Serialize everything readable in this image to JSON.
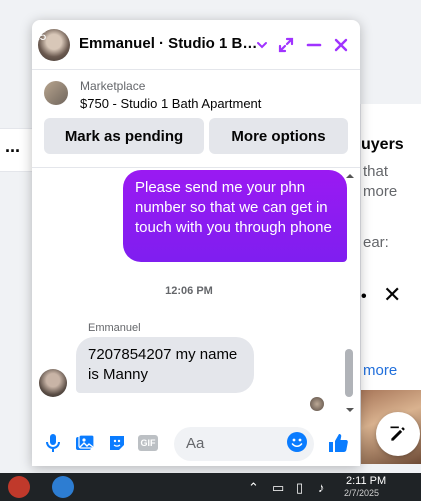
{
  "background": {
    "dots": "...",
    "right_heading": "uyers",
    "right_line1": "that",
    "right_line2": "more",
    "right_line3": "ear:",
    "right_dot": "•",
    "right_close": "✕",
    "right_more": "more"
  },
  "chat": {
    "header": {
      "avatar_label": "L5",
      "title": "Emmanuel · Studio 1 B…",
      "icons": [
        "chevron-down-icon",
        "expand-icon",
        "minimize-icon",
        "close-icon"
      ]
    },
    "marketplace": {
      "label": "Marketplace",
      "title": "$750 - Studio 1 Bath Apartment",
      "pending_button": "Mark as pending",
      "options_button": "More options"
    },
    "messages": {
      "outgoing": "Please send me your phn number so that we can get in touch with you through phone",
      "timestamp": "12:06 PM",
      "sender": "Emmanuel",
      "incoming": "7207854207 my name is Manny"
    },
    "composer": {
      "placeholder": "Aa",
      "gif_label": "GIF",
      "icons": [
        "microphone-icon",
        "photo-icon",
        "sticker-icon",
        "gif-icon",
        "emoji-icon",
        "thumbs-up-icon"
      ]
    }
  },
  "taskbar": {
    "time": "2:11 PM",
    "date": "2/7/2025"
  },
  "colors": {
    "accent": "#a033ff",
    "facebook_blue": "#0a7cff",
    "bubble_out": "#8f1cf1",
    "bubble_in": "#e4e6eb"
  }
}
